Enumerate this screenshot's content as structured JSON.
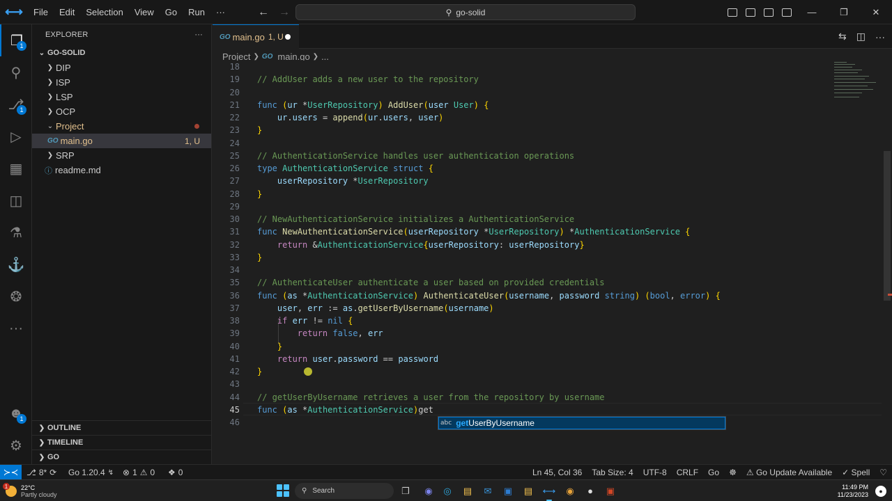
{
  "titlebar": {
    "menu": [
      "File",
      "Edit",
      "Selection",
      "View",
      "Go",
      "Run",
      "···"
    ],
    "search": "go-solid"
  },
  "activity": {
    "explorer_badge": "1",
    "scm_badge": "1",
    "accounts_badge": "1"
  },
  "sidebar": {
    "title": "EXPLORER",
    "root": "GO-SOLID",
    "items": [
      {
        "label": "DIP",
        "type": "folder"
      },
      {
        "label": "ISP",
        "type": "folder"
      },
      {
        "label": "LSP",
        "type": "folder"
      },
      {
        "label": "OCP",
        "type": "folder"
      },
      {
        "label": "Project",
        "type": "folder-open"
      },
      {
        "label": "main.go",
        "type": "file",
        "status": "1, U"
      },
      {
        "label": "SRP",
        "type": "folder"
      },
      {
        "label": "readme.md",
        "type": "md"
      }
    ],
    "sections": [
      "OUTLINE",
      "TIMELINE",
      "GO"
    ]
  },
  "tab": {
    "label": "main.go",
    "status": "1, U"
  },
  "breadcrumbs": {
    "folder": "Project",
    "file": "main.go",
    "more": "..."
  },
  "code": {
    "current_line": 45,
    "lines": [
      {
        "n": "18",
        "t": ""
      },
      {
        "n": "19",
        "t": "// AddUser adds a new user to the repository"
      },
      {
        "n": "20",
        "t": ""
      },
      {
        "n": "21",
        "t": "func (ur *UserRepository) AddUser(user User) {"
      },
      {
        "n": "22",
        "t": "    ur.users = append(ur.users, user)"
      },
      {
        "n": "23",
        "t": "}"
      },
      {
        "n": "24",
        "t": ""
      },
      {
        "n": "25",
        "t": "// AuthenticationService handles user authentication operations"
      },
      {
        "n": "26",
        "t": "type AuthenticationService struct {"
      },
      {
        "n": "27",
        "t": "    userRepository *UserRepository"
      },
      {
        "n": "28",
        "t": "}"
      },
      {
        "n": "29",
        "t": ""
      },
      {
        "n": "30",
        "t": "// NewAuthenticationService initializes a AuthenticationService"
      },
      {
        "n": "31",
        "t": "func NewAuthenticationService(userRepository *UserRepository) *AuthenticationService {"
      },
      {
        "n": "32",
        "t": "    return &AuthenticationService{userRepository: userRepository}"
      },
      {
        "n": "33",
        "t": "}"
      },
      {
        "n": "34",
        "t": ""
      },
      {
        "n": "35",
        "t": "// AuthenticateUser authenticate a user based on provided credentials"
      },
      {
        "n": "36",
        "t": "func (as *AuthenticationService) AuthenticateUser(username, password string) (bool, error) {"
      },
      {
        "n": "37",
        "t": "    user, err := as.getUserByUsername(username)"
      },
      {
        "n": "38",
        "t": "    if err != nil {"
      },
      {
        "n": "39",
        "t": "        return false, err"
      },
      {
        "n": "40",
        "t": "    }"
      },
      {
        "n": "41",
        "t": "    return user.password == password"
      },
      {
        "n": "42",
        "t": "}"
      },
      {
        "n": "43",
        "t": ""
      },
      {
        "n": "44",
        "t": "// getUserByUsername retrieves a user from the repository by username"
      },
      {
        "n": "45",
        "t": "func (as *AuthenticationService)get"
      },
      {
        "n": "46",
        "t": ""
      }
    ]
  },
  "suggestion": {
    "kind": "abc",
    "match": "get",
    "rest": "UserByUsername"
  },
  "statusbar": {
    "branch": "8*",
    "go_version": "Go 1.20.4",
    "errors": "1",
    "warnings": "0",
    "ports": "0",
    "position": "Ln 45, Col 36",
    "tab_size": "Tab Size: 4",
    "encoding": "UTF-8",
    "eol": "CRLF",
    "language": "Go",
    "update": "Go Update Available",
    "spell": "Spell"
  },
  "taskbar": {
    "temp": "22°C",
    "weather": "Partly cloudy",
    "weather_badge": "1",
    "search": "Search",
    "time": "11:49 PM",
    "date": "11/23/2023"
  },
  "colors": {
    "accent": "#0078d4",
    "background": "#1f1f1f",
    "git_untracked": "#e2c08d"
  }
}
